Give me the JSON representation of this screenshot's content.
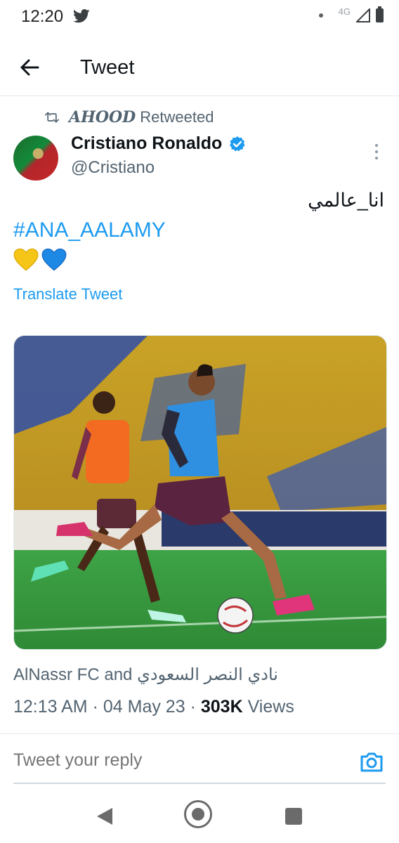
{
  "status_bar": {
    "time": "12:20",
    "network": "4G"
  },
  "header": {
    "title": "Tweet"
  },
  "retweet": {
    "name": "AHOOD",
    "label": "Retweeted"
  },
  "author": {
    "name": "Cristiano Ronaldo",
    "handle": "@Cristiano"
  },
  "tweet": {
    "text_arabic": "انا_عالمي",
    "hashtag": "#ANA_AALAMY",
    "emojis": [
      "yellow-heart",
      "blue-heart"
    ],
    "translate_label": "Translate Tweet"
  },
  "tagged": {
    "text": "AlNassr FC and نادي النصر السعودي"
  },
  "meta": {
    "time": "12:13 AM",
    "date": "04 May 23",
    "views_count": "303K",
    "views_label": "Views"
  },
  "reply": {
    "placeholder": "Tweet your reply"
  },
  "colors": {
    "accent": "#1d9bf0",
    "text": "#0f1419",
    "secondary": "#536471"
  }
}
